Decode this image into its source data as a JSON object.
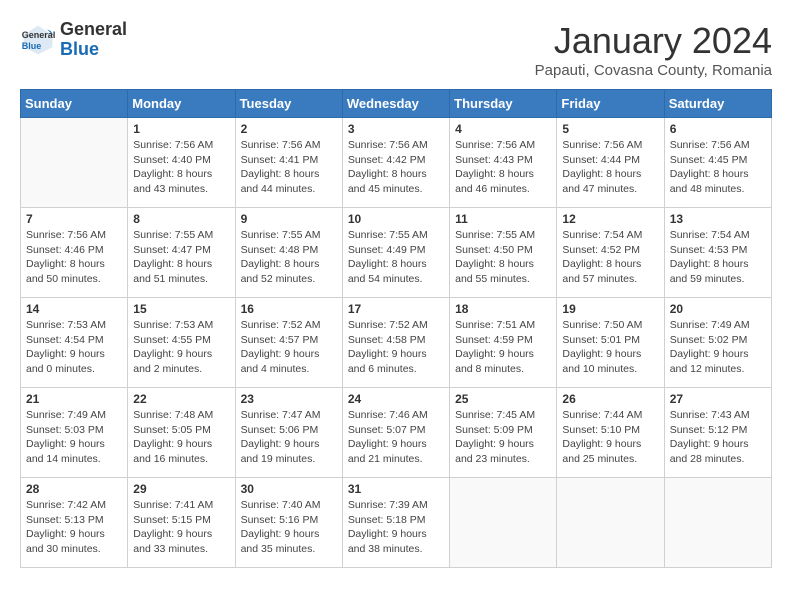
{
  "header": {
    "logo_general": "General",
    "logo_blue": "Blue",
    "month_title": "January 2024",
    "subtitle": "Papauti, Covasna County, Romania"
  },
  "days_of_week": [
    "Sunday",
    "Monday",
    "Tuesday",
    "Wednesday",
    "Thursday",
    "Friday",
    "Saturday"
  ],
  "weeks": [
    [
      {
        "day": "",
        "info": ""
      },
      {
        "day": "1",
        "info": "Sunrise: 7:56 AM\nSunset: 4:40 PM\nDaylight: 8 hours\nand 43 minutes."
      },
      {
        "day": "2",
        "info": "Sunrise: 7:56 AM\nSunset: 4:41 PM\nDaylight: 8 hours\nand 44 minutes."
      },
      {
        "day": "3",
        "info": "Sunrise: 7:56 AM\nSunset: 4:42 PM\nDaylight: 8 hours\nand 45 minutes."
      },
      {
        "day": "4",
        "info": "Sunrise: 7:56 AM\nSunset: 4:43 PM\nDaylight: 8 hours\nand 46 minutes."
      },
      {
        "day": "5",
        "info": "Sunrise: 7:56 AM\nSunset: 4:44 PM\nDaylight: 8 hours\nand 47 minutes."
      },
      {
        "day": "6",
        "info": "Sunrise: 7:56 AM\nSunset: 4:45 PM\nDaylight: 8 hours\nand 48 minutes."
      }
    ],
    [
      {
        "day": "7",
        "info": "Sunrise: 7:56 AM\nSunset: 4:46 PM\nDaylight: 8 hours\nand 50 minutes."
      },
      {
        "day": "8",
        "info": "Sunrise: 7:55 AM\nSunset: 4:47 PM\nDaylight: 8 hours\nand 51 minutes."
      },
      {
        "day": "9",
        "info": "Sunrise: 7:55 AM\nSunset: 4:48 PM\nDaylight: 8 hours\nand 52 minutes."
      },
      {
        "day": "10",
        "info": "Sunrise: 7:55 AM\nSunset: 4:49 PM\nDaylight: 8 hours\nand 54 minutes."
      },
      {
        "day": "11",
        "info": "Sunrise: 7:55 AM\nSunset: 4:50 PM\nDaylight: 8 hours\nand 55 minutes."
      },
      {
        "day": "12",
        "info": "Sunrise: 7:54 AM\nSunset: 4:52 PM\nDaylight: 8 hours\nand 57 minutes."
      },
      {
        "day": "13",
        "info": "Sunrise: 7:54 AM\nSunset: 4:53 PM\nDaylight: 8 hours\nand 59 minutes."
      }
    ],
    [
      {
        "day": "14",
        "info": "Sunrise: 7:53 AM\nSunset: 4:54 PM\nDaylight: 9 hours\nand 0 minutes."
      },
      {
        "day": "15",
        "info": "Sunrise: 7:53 AM\nSunset: 4:55 PM\nDaylight: 9 hours\nand 2 minutes."
      },
      {
        "day": "16",
        "info": "Sunrise: 7:52 AM\nSunset: 4:57 PM\nDaylight: 9 hours\nand 4 minutes."
      },
      {
        "day": "17",
        "info": "Sunrise: 7:52 AM\nSunset: 4:58 PM\nDaylight: 9 hours\nand 6 minutes."
      },
      {
        "day": "18",
        "info": "Sunrise: 7:51 AM\nSunset: 4:59 PM\nDaylight: 9 hours\nand 8 minutes."
      },
      {
        "day": "19",
        "info": "Sunrise: 7:50 AM\nSunset: 5:01 PM\nDaylight: 9 hours\nand 10 minutes."
      },
      {
        "day": "20",
        "info": "Sunrise: 7:49 AM\nSunset: 5:02 PM\nDaylight: 9 hours\nand 12 minutes."
      }
    ],
    [
      {
        "day": "21",
        "info": "Sunrise: 7:49 AM\nSunset: 5:03 PM\nDaylight: 9 hours\nand 14 minutes."
      },
      {
        "day": "22",
        "info": "Sunrise: 7:48 AM\nSunset: 5:05 PM\nDaylight: 9 hours\nand 16 minutes."
      },
      {
        "day": "23",
        "info": "Sunrise: 7:47 AM\nSunset: 5:06 PM\nDaylight: 9 hours\nand 19 minutes."
      },
      {
        "day": "24",
        "info": "Sunrise: 7:46 AM\nSunset: 5:07 PM\nDaylight: 9 hours\nand 21 minutes."
      },
      {
        "day": "25",
        "info": "Sunrise: 7:45 AM\nSunset: 5:09 PM\nDaylight: 9 hours\nand 23 minutes."
      },
      {
        "day": "26",
        "info": "Sunrise: 7:44 AM\nSunset: 5:10 PM\nDaylight: 9 hours\nand 25 minutes."
      },
      {
        "day": "27",
        "info": "Sunrise: 7:43 AM\nSunset: 5:12 PM\nDaylight: 9 hours\nand 28 minutes."
      }
    ],
    [
      {
        "day": "28",
        "info": "Sunrise: 7:42 AM\nSunset: 5:13 PM\nDaylight: 9 hours\nand 30 minutes."
      },
      {
        "day": "29",
        "info": "Sunrise: 7:41 AM\nSunset: 5:15 PM\nDaylight: 9 hours\nand 33 minutes."
      },
      {
        "day": "30",
        "info": "Sunrise: 7:40 AM\nSunset: 5:16 PM\nDaylight: 9 hours\nand 35 minutes."
      },
      {
        "day": "31",
        "info": "Sunrise: 7:39 AM\nSunset: 5:18 PM\nDaylight: 9 hours\nand 38 minutes."
      },
      {
        "day": "",
        "info": ""
      },
      {
        "day": "",
        "info": ""
      },
      {
        "day": "",
        "info": ""
      }
    ]
  ]
}
